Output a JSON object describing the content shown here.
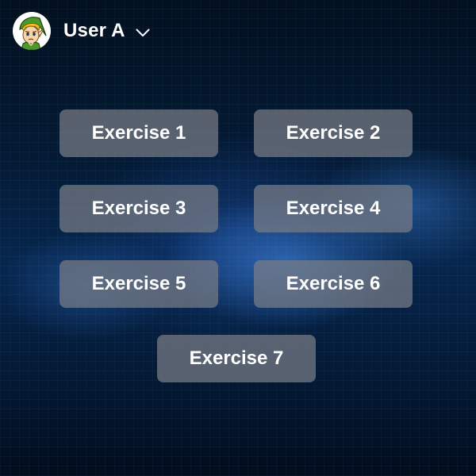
{
  "user": {
    "name": "User A",
    "avatar_icon": "elf-character-avatar",
    "menu_icon": "chevron-down-icon"
  },
  "exercises": [
    {
      "label": "Exercise 1"
    },
    {
      "label": "Exercise 2"
    },
    {
      "label": "Exercise 3"
    },
    {
      "label": "Exercise 4"
    },
    {
      "label": "Exercise 5"
    },
    {
      "label": "Exercise 6"
    },
    {
      "label": "Exercise 7"
    }
  ],
  "colors": {
    "background": "#041b36",
    "button_fill": "#787d87",
    "text": "#ffffff"
  }
}
